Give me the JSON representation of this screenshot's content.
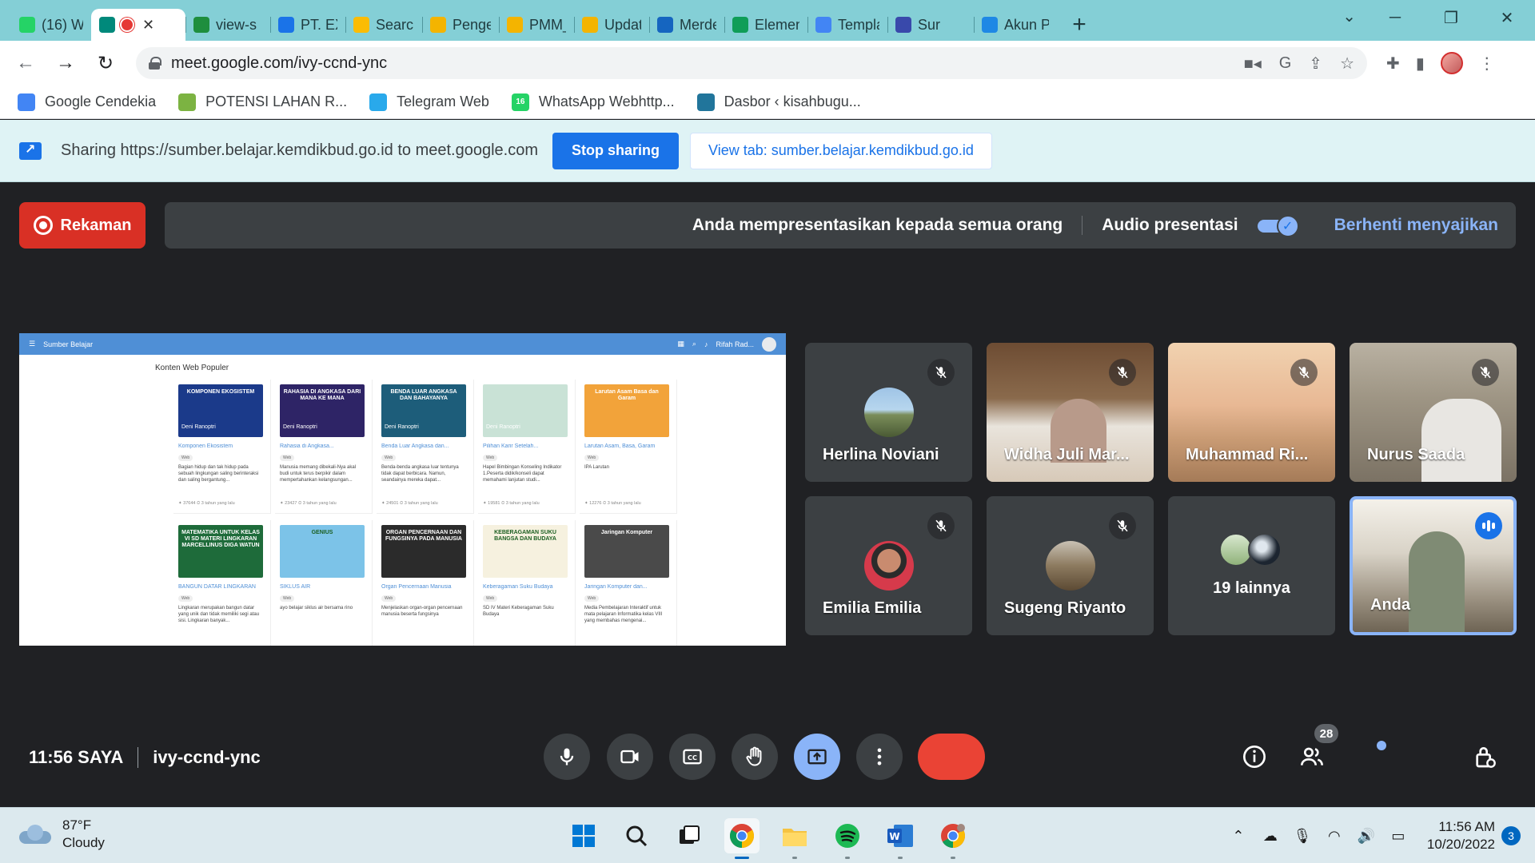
{
  "browser": {
    "tabs": [
      {
        "title": "(16) W",
        "icon": "whatsapp-icon",
        "color": "#25d366",
        "badge": "16"
      },
      {
        "title": "",
        "icon": "meet-icon",
        "color": "#00897b",
        "active": true,
        "recording": true
      },
      {
        "title": "view-s",
        "icon": "sheets-icon",
        "color": "#1e8e3e"
      },
      {
        "title": "PT. EX",
        "icon": "edge-icon",
        "color": "#1a73e8"
      },
      {
        "title": "Search",
        "icon": "drive-icon",
        "color": "#fbbc04"
      },
      {
        "title": "Penger",
        "icon": "slides-icon",
        "color": "#f4b400"
      },
      {
        "title": "PMM_",
        "icon": "slides-icon",
        "color": "#f4b400"
      },
      {
        "title": "Update",
        "icon": "slides-icon",
        "color": "#f4b400"
      },
      {
        "title": "Merde",
        "icon": "merdeka-icon",
        "color": "#1565c0"
      },
      {
        "title": "Elemen",
        "icon": "drive-icon",
        "color": "#0f9d58"
      },
      {
        "title": "Templa",
        "icon": "forms-icon",
        "color": "#4285f4"
      },
      {
        "title": "Sur",
        "icon": "ministry-icon",
        "color": "#3949ab"
      },
      {
        "title": "Akun P",
        "icon": "ministry-icon",
        "color": "#1e88e5"
      }
    ],
    "url": "meet.google.com/ivy-ccnd-ync",
    "bookmarks": [
      {
        "label": "Google Cendekia",
        "icon": "scholar-icon",
        "color": "#4285f4"
      },
      {
        "label": "POTENSI LAHAN R...",
        "icon": "ministry-logo-icon",
        "color": "#7cb342"
      },
      {
        "label": "Telegram Web",
        "icon": "telegram-icon",
        "color": "#29a9eb"
      },
      {
        "label": "WhatsApp Webhttp...",
        "icon": "whatsapp-icon",
        "color": "#25d366",
        "badge": "16"
      },
      {
        "label": "Dasbor ‹ kisahbugu...",
        "icon": "wordpress-icon",
        "color": "#21759b"
      }
    ],
    "sharing": {
      "text": "Sharing https://sumber.belajar.kemdikbud.go.id to meet.google.com",
      "stop_label": "Stop sharing",
      "view_label": "View tab: sumber.belajar.kemdikbud.go.id"
    }
  },
  "meet": {
    "recording_label": "Rekaman",
    "presenting_msg": "Anda mempresentasikan kepada semua orang",
    "audio_label": "Audio presentasi",
    "audio_on": true,
    "stop_presenting": "Berhenti menyajikan",
    "time": "11:56 SAYA",
    "meeting_code": "ivy-ccnd-ync",
    "participant_count": "28",
    "participants": [
      {
        "name": "Herlina Noviani",
        "muted": true,
        "mode": "avatar"
      },
      {
        "name": "Widha Juli Mar...",
        "muted": true,
        "mode": "video"
      },
      {
        "name": "Muhammad Ri...",
        "muted": true,
        "mode": "video"
      },
      {
        "name": "Nurus Saada",
        "muted": true,
        "mode": "video"
      },
      {
        "name": "Emilia Emilia",
        "muted": true,
        "mode": "avatar"
      },
      {
        "name": "Sugeng Riyanto",
        "muted": true,
        "mode": "avatar"
      },
      {
        "name": "19 lainnya",
        "mode": "more"
      },
      {
        "name": "Anda",
        "mode": "self",
        "speaking": true
      }
    ],
    "shared_screen": {
      "site_name": "Sumber Belajar",
      "user_label": "Rifah Rad...",
      "section_title": "Konten Web Populer",
      "cards": [
        {
          "title": "Komponen Ekosistem",
          "tag": "Web",
          "thumb": "KOMPONEN EKOSISTEM",
          "author": "Deni Ranoptri",
          "desc": "Bagian hidup dan tak hidup pada sebuah lingkungan saling berinteraksi dan saling bergantung...",
          "meta": "✦ 37644   ⏲ 3 tahun yang lalu",
          "color": "#1b3a8a"
        },
        {
          "title": "Rahasia di Angkasa...",
          "tag": "Web",
          "thumb": "RAHASIA DI ANGKASA DARI MANA KE MANA",
          "author": "Deni Ranoptri",
          "desc": "Manusia memang dibekali-Nya akal budi untuk terus berpikir dalam mempertahankan kelangsungan...",
          "meta": "✦ 23427   ⏲ 3 tahun yang lalu",
          "color": "#2e2466"
        },
        {
          "title": "Benda Luar Angkasa dan...",
          "tag": "Web",
          "thumb": "BENDA LUAR ANGKASA DAN BAHAYANYA",
          "author": "Deni Ranoptri",
          "desc": "Benda-benda angkasa luar tentunya tidak dapat berbicara. Namun, seandainya mereka dapat...",
          "meta": "✦ 24501   ⏲ 3 tahun yang lalu",
          "color": "#1d5d7a"
        },
        {
          "title": "Pilihan Karir Setelah...",
          "tag": "Web",
          "thumb": "",
          "author": "Deni Ranoptri",
          "desc": "Hapel Bimbingan Konseling Indikator 1.Peserta didik/konseli dapat memahami lanjutan studi...",
          "meta": "✦ 19581   ⏲ 3 tahun yang lalu",
          "color": "#c9e2d6"
        },
        {
          "title": "Larutan Asam, Basa, Garam",
          "tag": "Web",
          "thumb": "Larutan Asam Basa dan Garam",
          "author": "",
          "desc": "IPA Larutan",
          "meta": "✦ 12276   ⏲ 3 tahun yang lalu",
          "color": "#f2a33a"
        },
        {
          "title": "BANGUN DATAR LINGKARAN",
          "tag": "Web",
          "thumb": "MATEMATIKA UNTUK KELAS VI SD MATERI LINGKARAN MARCELLINUS DIGA WATUN",
          "author": "",
          "desc": "Lingkaran merupakan bangun datar yang unik dan tidak memiliki segi atau sisi. Lingkaran banyak...",
          "meta": "",
          "color": "#1e6b3a"
        },
        {
          "title": "SIKLUS AIR",
          "tag": "Web",
          "thumb": "GENIUS",
          "author": "",
          "desc": "ayo belajar siklus air bersama rino",
          "meta": "",
          "color": "#7cc3e8"
        },
        {
          "title": "Organ Pencernaan Manusia",
          "tag": "Web",
          "thumb": "ORGAN PENCERNAAN DAN FUNGSINYA PADA MANUSIA",
          "author": "",
          "desc": "Menjelaskan organ-organ pencernaan manusia beserta fungsinya",
          "meta": "",
          "color": "#2b2b2b"
        },
        {
          "title": "Keberagaman Suku Budaya",
          "tag": "Web",
          "thumb": "KEBERAGAMAN SUKU BANGSA DAN BUDAYA",
          "author": "",
          "desc": "SD IV Materi Keberagaman Suku Budaya",
          "meta": "",
          "color": "#f6f1df"
        },
        {
          "title": "Jaringan Komputer dan...",
          "tag": "Web",
          "thumb": "Jaringan Komputer",
          "author": "",
          "desc": "Media Pembelajaran Interaktif untuk mata pelajaran Informatika kelas VIII yang membahas mengenai...",
          "meta": "",
          "color": "#4a4a4a"
        }
      ]
    }
  },
  "taskbar": {
    "temp": "87°F",
    "condition": "Cloudy",
    "time": "11:56 AM",
    "date": "10/20/2022",
    "notifications": "3"
  }
}
